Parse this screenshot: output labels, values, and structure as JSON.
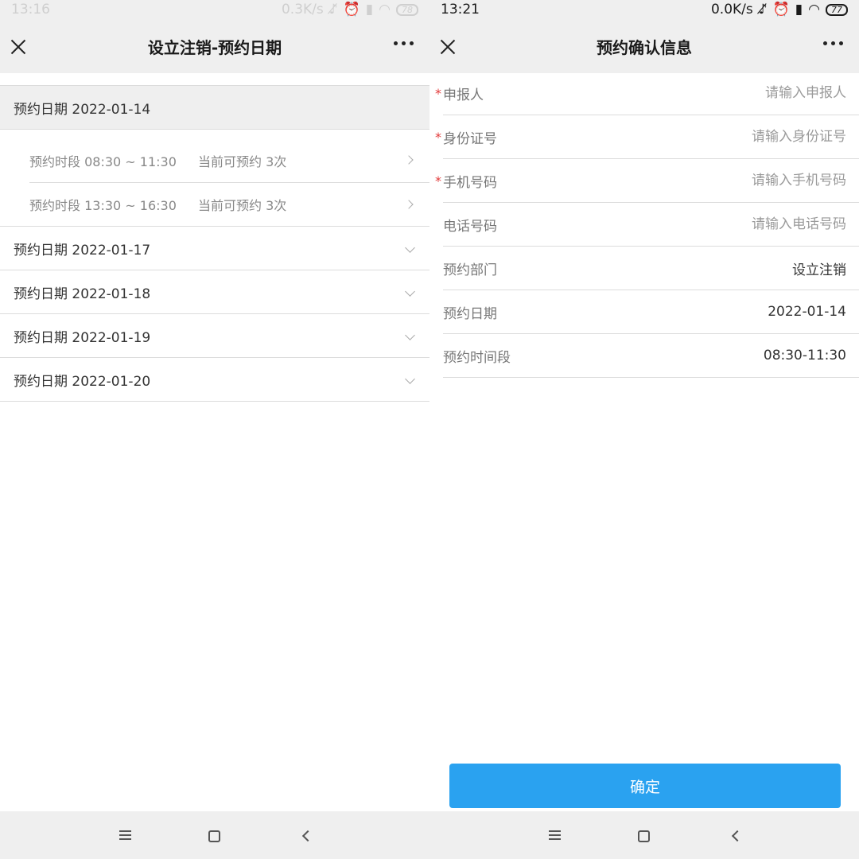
{
  "left": {
    "status": {
      "time": "13:16",
      "speed": "0.3K/s",
      "battery": "78"
    },
    "title": "设立注销-预约日期",
    "expanded_date": "预约日期 2022-01-14",
    "slots": [
      {
        "time": "预约时段 08:30 ~ 11:30",
        "available": "当前可预约 3次"
      },
      {
        "time": "预约时段 13:30 ~ 16:30",
        "available": "当前可预约 3次"
      }
    ],
    "dates": [
      "预约日期 2022-01-17",
      "预约日期 2022-01-18",
      "预约日期 2022-01-19",
      "预约日期 2022-01-20"
    ]
  },
  "right": {
    "status": {
      "time": "13:21",
      "speed": "0.0K/s",
      "battery": "77"
    },
    "title": "预约确认信息",
    "required_mark": "*",
    "fields": {
      "applicant": {
        "label": "申报人",
        "placeholder": "请输入申报人"
      },
      "id_number": {
        "label": "身份证号",
        "placeholder": "请输入身份证号"
      },
      "mobile": {
        "label": "手机号码",
        "placeholder": "请输入手机号码"
      },
      "phone": {
        "label": "电话号码",
        "placeholder": "请输入电话号码"
      },
      "department": {
        "label": "预约部门",
        "value": "设立注销"
      },
      "date": {
        "label": "预约日期",
        "value": "2022-01-14"
      },
      "period": {
        "label": "预约时间段",
        "value": "08:30-11:30"
      }
    },
    "confirm_label": "确定"
  },
  "icons": {
    "close": "close-icon",
    "more": "more-dots-icon",
    "chevron_down": "chevron-down-icon",
    "chevron_right": "chevron-right-icon",
    "nav_menu": "menu-icon",
    "nav_home": "home-icon",
    "nav_back": "back-icon"
  },
  "colors": {
    "accent": "#2aa2f0",
    "required": "#e23a3a",
    "bar_bg": "#efefef"
  }
}
